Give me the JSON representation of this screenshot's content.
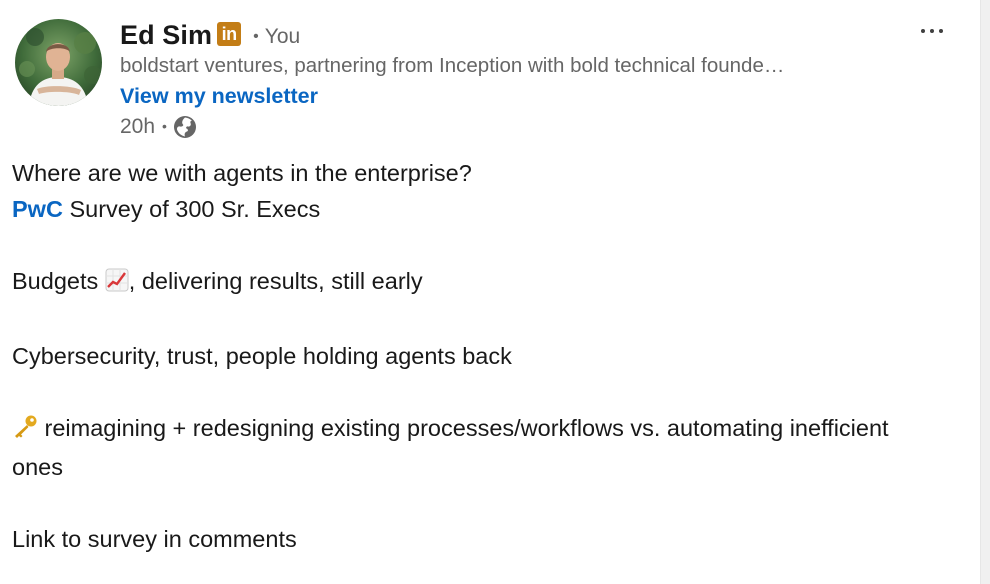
{
  "author": {
    "name": "Ed Sim",
    "badge": "in",
    "connection": "You",
    "headline": "boldstart ventures, partnering from Inception with bold technical founde…",
    "newsletter_link": "View my newsletter",
    "time_ago": "20h",
    "visibility_icon": "globe-icon",
    "avatar_icon": "profile-photo"
  },
  "post": {
    "lines": {
      "line1": "Where are we with agents in the enterprise?",
      "mention": "PwC",
      "line2_rest": " Survey of 300 Sr. Execs",
      "line3_a": "Budgets ",
      "line3_emoji": "chart-increasing-emoji",
      "line3_b": ", delivering results, still early",
      "line4": "Cybersecurity, trust, people holding agents back",
      "line5_emoji": "key-emoji",
      "line5": " reimagining + redesigning existing processes/workflows vs. automating inefficient ones",
      "line6": "Link to survey in comments"
    }
  },
  "colors": {
    "link_blue": "#0a66c2",
    "badge_gold": "#c37d16",
    "muted": "#666666",
    "text": "#191919"
  }
}
